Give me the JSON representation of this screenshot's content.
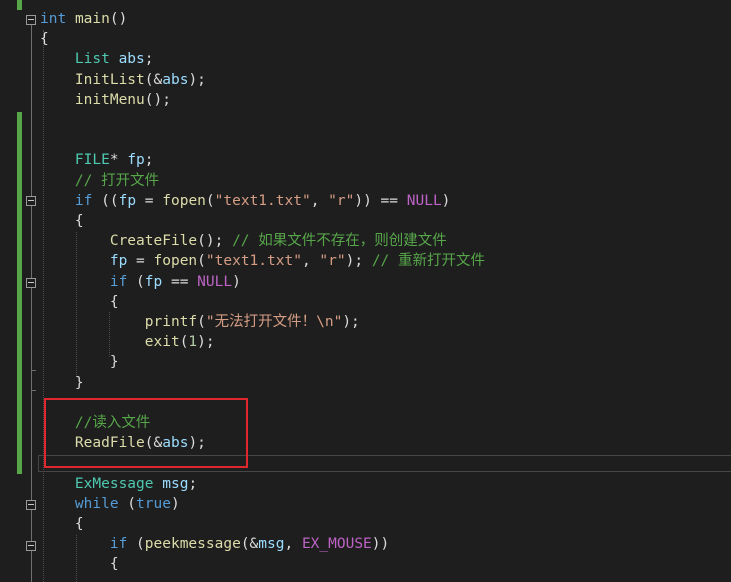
{
  "editor": {
    "language": "C/C++",
    "colors": {
      "background": "#1e1e1e",
      "keyword": "#569cd6",
      "type": "#4ec9b0",
      "function": "#dcdcaa",
      "variable": "#9cdcfe",
      "string": "#d69d85",
      "comment": "#57a64a",
      "macro": "#bd63c5",
      "number": "#b5cea8",
      "changed_line_marker": "#57a64a",
      "highlight_box": "#e0262e"
    },
    "highlight_box_annotation": "red rectangle around the read-file lines",
    "lines": [
      {
        "n": 1,
        "tokens": [
          {
            "t": "int",
            "c": "kw"
          },
          {
            "t": " ",
            "c": "pn"
          },
          {
            "t": "main",
            "c": "fn"
          },
          {
            "t": "()",
            "c": "pn"
          }
        ]
      },
      {
        "n": 2,
        "tokens": [
          {
            "t": "{",
            "c": "pn"
          }
        ]
      },
      {
        "n": 3,
        "tokens": [
          {
            "t": "    ",
            "c": "pn"
          },
          {
            "t": "List",
            "c": "ty"
          },
          {
            "t": " ",
            "c": "pn"
          },
          {
            "t": "abs",
            "c": "vr"
          },
          {
            "t": ";",
            "c": "pn"
          }
        ]
      },
      {
        "n": 4,
        "tokens": [
          {
            "t": "    ",
            "c": "pn"
          },
          {
            "t": "InitList",
            "c": "fn"
          },
          {
            "t": "(&",
            "c": "pn"
          },
          {
            "t": "abs",
            "c": "vr"
          },
          {
            "t": ");",
            "c": "pn"
          }
        ]
      },
      {
        "n": 5,
        "tokens": [
          {
            "t": "    ",
            "c": "pn"
          },
          {
            "t": "initMenu",
            "c": "fn"
          },
          {
            "t": "();",
            "c": "pn"
          }
        ]
      },
      {
        "n": 6,
        "tokens": []
      },
      {
        "n": 7,
        "tokens": []
      },
      {
        "n": 8,
        "tokens": [
          {
            "t": "    ",
            "c": "pn"
          },
          {
            "t": "FILE",
            "c": "ty"
          },
          {
            "t": "* ",
            "c": "pn"
          },
          {
            "t": "fp",
            "c": "vr"
          },
          {
            "t": ";",
            "c": "pn"
          }
        ]
      },
      {
        "n": 9,
        "tokens": [
          {
            "t": "    ",
            "c": "pn"
          },
          {
            "t": "// 打开文件",
            "c": "cm"
          }
        ]
      },
      {
        "n": 10,
        "tokens": [
          {
            "t": "    ",
            "c": "pn"
          },
          {
            "t": "if",
            "c": "kw"
          },
          {
            "t": " ((",
            "c": "pn"
          },
          {
            "t": "fp",
            "c": "vr"
          },
          {
            "t": " = ",
            "c": "pn"
          },
          {
            "t": "fopen",
            "c": "fn"
          },
          {
            "t": "(",
            "c": "pn"
          },
          {
            "t": "\"text1.txt\"",
            "c": "st"
          },
          {
            "t": ", ",
            "c": "pn"
          },
          {
            "t": "\"r\"",
            "c": "st"
          },
          {
            "t": ")) == ",
            "c": "pn"
          },
          {
            "t": "NULL",
            "c": "mc"
          },
          {
            "t": ")",
            "c": "pn"
          }
        ]
      },
      {
        "n": 11,
        "tokens": [
          {
            "t": "    {",
            "c": "pn"
          }
        ]
      },
      {
        "n": 12,
        "tokens": [
          {
            "t": "        ",
            "c": "pn"
          },
          {
            "t": "CreateFile",
            "c": "fn"
          },
          {
            "t": "(); ",
            "c": "pn"
          },
          {
            "t": "// 如果文件不存在，则创建文件",
            "c": "cm"
          }
        ]
      },
      {
        "n": 13,
        "tokens": [
          {
            "t": "        ",
            "c": "pn"
          },
          {
            "t": "fp",
            "c": "vr"
          },
          {
            "t": " = ",
            "c": "pn"
          },
          {
            "t": "fopen",
            "c": "fn"
          },
          {
            "t": "(",
            "c": "pn"
          },
          {
            "t": "\"text1.txt\"",
            "c": "st"
          },
          {
            "t": ", ",
            "c": "pn"
          },
          {
            "t": "\"r\"",
            "c": "st"
          },
          {
            "t": "); ",
            "c": "pn"
          },
          {
            "t": "// 重新打开文件",
            "c": "cm"
          }
        ]
      },
      {
        "n": 14,
        "tokens": [
          {
            "t": "        ",
            "c": "pn"
          },
          {
            "t": "if",
            "c": "kw"
          },
          {
            "t": " (",
            "c": "pn"
          },
          {
            "t": "fp",
            "c": "vr"
          },
          {
            "t": " == ",
            "c": "pn"
          },
          {
            "t": "NULL",
            "c": "mc"
          },
          {
            "t": ")",
            "c": "pn"
          }
        ]
      },
      {
        "n": 15,
        "tokens": [
          {
            "t": "        {",
            "c": "pn"
          }
        ]
      },
      {
        "n": 16,
        "tokens": [
          {
            "t": "            ",
            "c": "pn"
          },
          {
            "t": "printf",
            "c": "fn"
          },
          {
            "t": "(",
            "c": "pn"
          },
          {
            "t": "\"无法打开文件！\\n\"",
            "c": "st"
          },
          {
            "t": ");",
            "c": "pn"
          }
        ]
      },
      {
        "n": 17,
        "tokens": [
          {
            "t": "            ",
            "c": "pn"
          },
          {
            "t": "exit",
            "c": "fn"
          },
          {
            "t": "(",
            "c": "pn"
          },
          {
            "t": "1",
            "c": "nm"
          },
          {
            "t": ");",
            "c": "pn"
          }
        ]
      },
      {
        "n": 18,
        "tokens": [
          {
            "t": "        }",
            "c": "pn"
          }
        ]
      },
      {
        "n": 19,
        "tokens": [
          {
            "t": "    }",
            "c": "pn"
          }
        ]
      },
      {
        "n": 20,
        "tokens": []
      },
      {
        "n": 21,
        "tokens": [
          {
            "t": "    ",
            "c": "pn"
          },
          {
            "t": "//读入文件",
            "c": "cm"
          }
        ]
      },
      {
        "n": 22,
        "tokens": [
          {
            "t": "    ",
            "c": "pn"
          },
          {
            "t": "ReadFile",
            "c": "fn"
          },
          {
            "t": "(&",
            "c": "pn"
          },
          {
            "t": "abs",
            "c": "vr"
          },
          {
            "t": ");",
            "c": "pn"
          }
        ]
      },
      {
        "n": 23,
        "tokens": []
      },
      {
        "n": 24,
        "tokens": [
          {
            "t": "    ",
            "c": "pn"
          },
          {
            "t": "ExMessage",
            "c": "ty"
          },
          {
            "t": " ",
            "c": "pn"
          },
          {
            "t": "msg",
            "c": "vr"
          },
          {
            "t": ";",
            "c": "pn"
          }
        ]
      },
      {
        "n": 25,
        "tokens": [
          {
            "t": "    ",
            "c": "pn"
          },
          {
            "t": "while",
            "c": "kw"
          },
          {
            "t": " (",
            "c": "pn"
          },
          {
            "t": "true",
            "c": "kw"
          },
          {
            "t": ")",
            "c": "pn"
          }
        ]
      },
      {
        "n": 26,
        "tokens": [
          {
            "t": "    {",
            "c": "pn"
          }
        ]
      },
      {
        "n": 27,
        "tokens": [
          {
            "t": "        ",
            "c": "pn"
          },
          {
            "t": "if",
            "c": "kw"
          },
          {
            "t": " (",
            "c": "pn"
          },
          {
            "t": "peekmessage",
            "c": "fn"
          },
          {
            "t": "(&",
            "c": "pn"
          },
          {
            "t": "msg",
            "c": "vr"
          },
          {
            "t": ", ",
            "c": "pn"
          },
          {
            "t": "EX_MOUSE",
            "c": "mc"
          },
          {
            "t": "))",
            "c": "pn"
          }
        ]
      },
      {
        "n": 28,
        "tokens": [
          {
            "t": "        {",
            "c": "pn"
          }
        ]
      }
    ]
  }
}
